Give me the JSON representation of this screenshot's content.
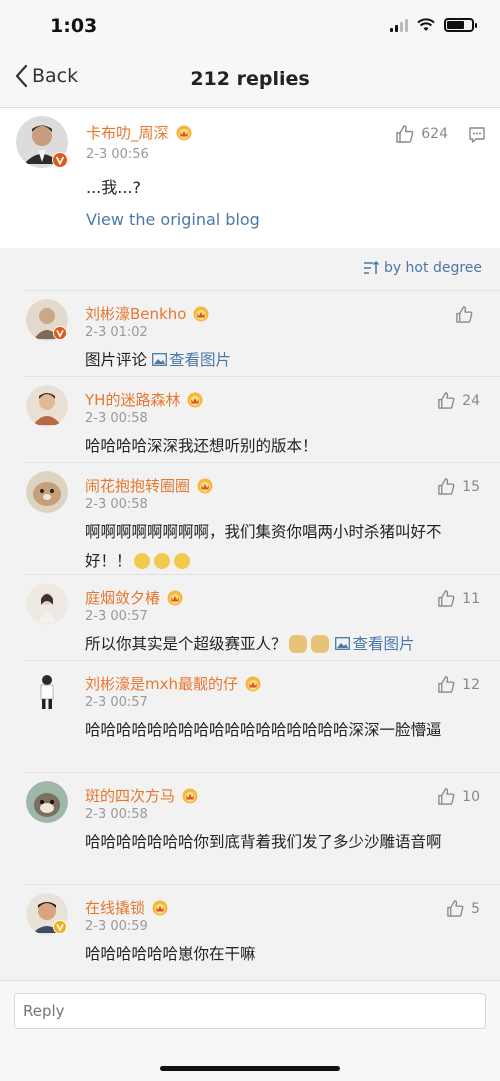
{
  "status_bar": {
    "time": "1:03"
  },
  "nav": {
    "back_label": "Back",
    "title": "212 replies"
  },
  "original": {
    "author": "卡布叻_周深",
    "time": "2-3 00:56",
    "text": "...我...?",
    "likes": "624",
    "view_original": "View the original blog"
  },
  "sort": {
    "label": "by hot degree"
  },
  "replies": [
    {
      "name": "刘彬濠Benkho",
      "time": "2-3 01:02",
      "likes": "",
      "text": "图片评论 ",
      "image_link": "查看图片",
      "verified": true,
      "avatar_color": "#c9a78a"
    },
    {
      "name": "YH的迷路森林",
      "time": "2-3 00:58",
      "likes": "24",
      "text": "哈哈哈哈深深我还想听别的版本！",
      "avatar_color": "#b56a45"
    },
    {
      "name": "闹花抱抱转圈圈",
      "time": "2-3 00:58",
      "likes": "15",
      "text": "啊啊啊啊啊啊啊啊，我们集资你唱两小时杀猪叫好不好！！",
      "avatar_color": "#c7b49a"
    },
    {
      "name": "庭烟敛夕椿",
      "time": "2-3 00:57",
      "likes": "11",
      "text": "所以你其实是个超级赛亚人？",
      "image_link": "查看图片",
      "avatar_color": "#d8d2c8"
    },
    {
      "name": "刘彬濠是mxh最靓的仔",
      "time": "2-3 00:57",
      "likes": "12",
      "text": "哈哈哈哈哈哈哈哈哈哈哈哈哈哈哈哈哈深深一脸懵逼",
      "avatar_color": "#e8ecef"
    },
    {
      "name": "斑的四次方马",
      "time": "2-3 00:58",
      "likes": "10",
      "text": "哈哈哈哈哈哈哈你到底背着我们发了多少沙雕语音啊",
      "avatar_color": "#9fb7a8"
    },
    {
      "name": "在线撬锁",
      "time": "2-3 00:59",
      "likes": "5",
      "text": "哈哈哈哈哈哈崽你在干嘛",
      "verified": true,
      "verified_color": "#f2b01e",
      "avatar_color": "#d9a47e"
    }
  ],
  "input": {
    "placeholder": "Reply"
  },
  "colors": {
    "name": "#e8772e",
    "link": "#4a78a8",
    "verified": "#e05a1c"
  }
}
